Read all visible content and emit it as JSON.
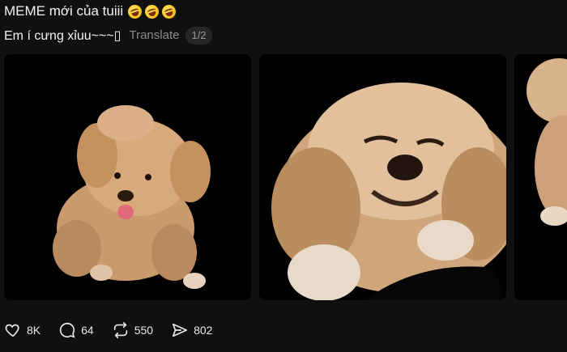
{
  "post": {
    "title": "MEME mới của tuiii",
    "emojis": [
      "rolling-on-floor-laughing",
      "rolling-on-floor-laughing",
      "rolling-on-floor-laughing"
    ],
    "subtitle": "Em í cưng xỉuu~~~▯",
    "translate_label": "Translate",
    "pager": "1/2"
  },
  "media": [
    {
      "desc": "fluffy dog image 1"
    },
    {
      "desc": "fluffy dog image 2"
    },
    {
      "desc": "fluffy dog image 3 partial"
    }
  ],
  "actions": {
    "likes": "8K",
    "comments": "64",
    "reposts": "550",
    "shares": "802"
  },
  "colors": {
    "background": "#101010",
    "tile_background": "#000000",
    "text": "#f3f3f3",
    "muted": "#8a8a8a",
    "dog_fur": "#d9b48a"
  }
}
